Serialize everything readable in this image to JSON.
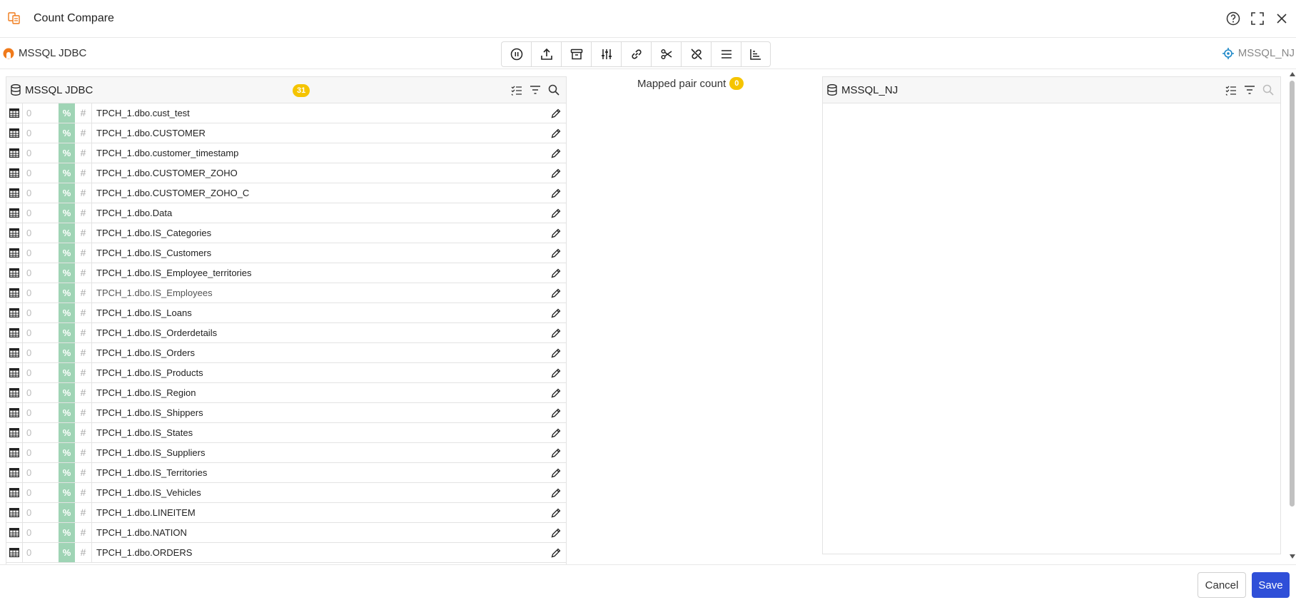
{
  "window": {
    "title": "Count Compare"
  },
  "connections": {
    "source": "MSSQL JDBC",
    "target": "MSSQL_NJ"
  },
  "toolbar": [
    {
      "icon": "pause-icon",
      "label": "Pause"
    },
    {
      "icon": "upload-icon",
      "label": "Upload"
    },
    {
      "icon": "archive-icon",
      "label": "Archive"
    },
    {
      "icon": "sliders-icon",
      "label": "Settings"
    },
    {
      "icon": "link-icon",
      "label": "Link"
    },
    {
      "icon": "scissors-icon",
      "label": "Cut"
    },
    {
      "icon": "unlink-icon",
      "label": "Unlink"
    },
    {
      "icon": "list-icon",
      "label": "List"
    },
    {
      "icon": "bar-chart-icon",
      "label": "Chart"
    }
  ],
  "left_panel": {
    "name": "MSSQL JDBC",
    "count": "31",
    "rows": [
      {
        "count": "0",
        "pct": "%",
        "hash": "#",
        "name": "TPCH_1.dbo.cust_test"
      },
      {
        "count": "0",
        "pct": "%",
        "hash": "#",
        "name": "TPCH_1.dbo.CUSTOMER"
      },
      {
        "count": "0",
        "pct": "%",
        "hash": "#",
        "name": "TPCH_1.dbo.customer_timestamp"
      },
      {
        "count": "0",
        "pct": "%",
        "hash": "#",
        "name": "TPCH_1.dbo.CUSTOMER_ZOHO"
      },
      {
        "count": "0",
        "pct": "%",
        "hash": "#",
        "name": "TPCH_1.dbo.CUSTOMER_ZOHO_C"
      },
      {
        "count": "0",
        "pct": "%",
        "hash": "#",
        "name": "TPCH_1.dbo.Data"
      },
      {
        "count": "0",
        "pct": "%",
        "hash": "#",
        "name": "TPCH_1.dbo.IS_Categories"
      },
      {
        "count": "0",
        "pct": "%",
        "hash": "#",
        "name": "TPCH_1.dbo.IS_Customers"
      },
      {
        "count": "0",
        "pct": "%",
        "hash": "#",
        "name": "TPCH_1.dbo.IS_Employee_territories"
      },
      {
        "count": "0",
        "pct": "%",
        "hash": "#",
        "name": "TPCH_1.dbo.IS_Employees",
        "muted": true
      },
      {
        "count": "0",
        "pct": "%",
        "hash": "#",
        "name": "TPCH_1.dbo.IS_Loans"
      },
      {
        "count": "0",
        "pct": "%",
        "hash": "#",
        "name": "TPCH_1.dbo.IS_Orderdetails"
      },
      {
        "count": "0",
        "pct": "%",
        "hash": "#",
        "name": "TPCH_1.dbo.IS_Orders"
      },
      {
        "count": "0",
        "pct": "%",
        "hash": "#",
        "name": "TPCH_1.dbo.IS_Products"
      },
      {
        "count": "0",
        "pct": "%",
        "hash": "#",
        "name": "TPCH_1.dbo.IS_Region"
      },
      {
        "count": "0",
        "pct": "%",
        "hash": "#",
        "name": "TPCH_1.dbo.IS_Shippers"
      },
      {
        "count": "0",
        "pct": "%",
        "hash": "#",
        "name": "TPCH_1.dbo.IS_States"
      },
      {
        "count": "0",
        "pct": "%",
        "hash": "#",
        "name": "TPCH_1.dbo.IS_Suppliers"
      },
      {
        "count": "0",
        "pct": "%",
        "hash": "#",
        "name": "TPCH_1.dbo.IS_Territories"
      },
      {
        "count": "0",
        "pct": "%",
        "hash": "#",
        "name": "TPCH_1.dbo.IS_Vehicles"
      },
      {
        "count": "0",
        "pct": "%",
        "hash": "#",
        "name": "TPCH_1.dbo.LINEITEM"
      },
      {
        "count": "0",
        "pct": "%",
        "hash": "#",
        "name": "TPCH_1.dbo.NATION"
      },
      {
        "count": "0",
        "pct": "%",
        "hash": "#",
        "name": "TPCH_1.dbo.ORDERS"
      }
    ]
  },
  "mapped": {
    "label": "Mapped pair count",
    "count": "0"
  },
  "right_panel": {
    "name": "MSSQL_NJ"
  },
  "footer": {
    "cancel_label": "Cancel",
    "save_label": "Save"
  },
  "colors": {
    "accent": "#2f4fd8",
    "badge": "#f5c400",
    "pct_bg": "#9fd4b5",
    "source_conn": "#f07a1a",
    "target_conn": "#1e88c8"
  }
}
